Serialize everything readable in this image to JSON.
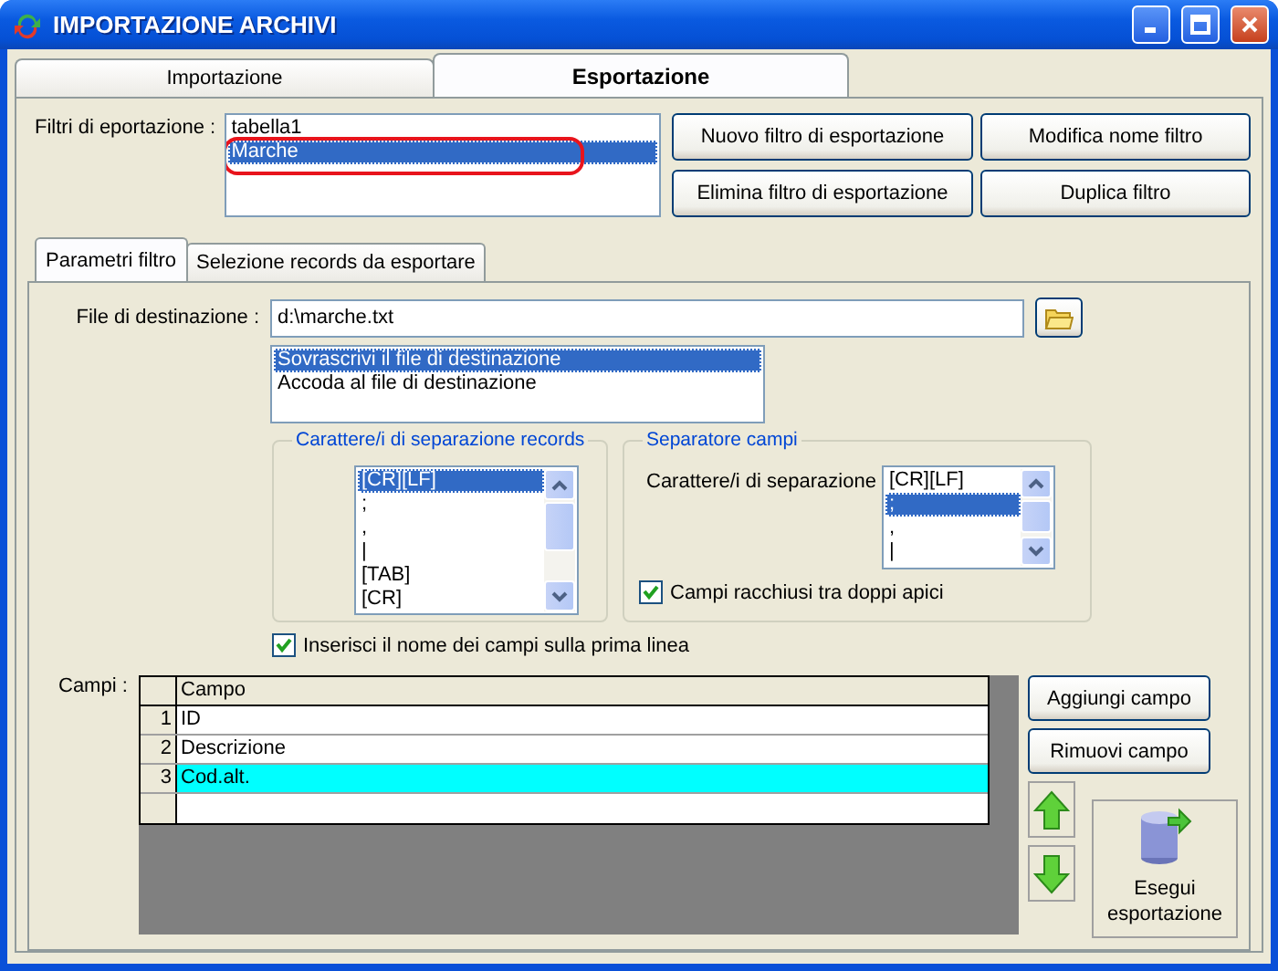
{
  "window": {
    "title": "IMPORTAZIONE ARCHIVI"
  },
  "tabs": [
    {
      "label": "Importazione",
      "selected": false
    },
    {
      "label": "Esportazione",
      "selected": true
    }
  ],
  "filters": {
    "label": "Filtri di eportazione :",
    "items": [
      {
        "label": "tabella1",
        "selected": false,
        "circled": false
      },
      {
        "label": "Marche",
        "selected": true,
        "circled": true
      }
    ]
  },
  "filter_buttons": [
    "Nuovo filtro di esportazione",
    "Modifica nome filtro",
    "Elimina filtro di esportazione",
    "Duplica filtro"
  ],
  "subtabs": [
    {
      "label": "Parametri filtro",
      "selected": true
    },
    {
      "label": "Selezione records da esportare",
      "selected": false
    }
  ],
  "destination": {
    "label": "File di destinazione :",
    "value": "d:\\marche.txt"
  },
  "write_mode": [
    {
      "label": "Sovrascrivi il file di destinazione",
      "selected": true
    },
    {
      "label": "Accoda al file di destinazione",
      "selected": false
    }
  ],
  "record_separator": {
    "title": "Carattere/i di separazione records",
    "items": [
      {
        "label": "[CR][LF]",
        "selected": true
      },
      {
        "label": ";",
        "selected": false
      },
      {
        "label": ",",
        "selected": false
      },
      {
        "label": "|",
        "selected": false
      },
      {
        "label": "[TAB]",
        "selected": false
      },
      {
        "label": "[CR]",
        "selected": false
      }
    ]
  },
  "field_separator": {
    "title": "Separatore campi",
    "label": "Carattere/i di separazione",
    "items": [
      {
        "label": "[CR][LF]",
        "selected": false
      },
      {
        "label": ";",
        "selected": true
      },
      {
        "label": ",",
        "selected": false
      },
      {
        "label": "|",
        "selected": false
      }
    ],
    "quoted": {
      "label": "Campi racchiusi tra doppi apici",
      "checked": true
    }
  },
  "header_line": {
    "label": "Inserisci il nome dei campi sulla prima linea",
    "checked": true
  },
  "fields": {
    "label": "Campi :",
    "column": "Campo",
    "rows": [
      {
        "number": "1",
        "name": "ID",
        "selected": false
      },
      {
        "number": "2",
        "name": "Descrizione",
        "selected": false
      },
      {
        "number": "3",
        "name": "Cod.alt.",
        "selected": true
      }
    ]
  },
  "field_buttons": [
    "Aggiungi campo",
    "Rimuovi campo"
  ],
  "export_button": "Esegui esportazione"
}
